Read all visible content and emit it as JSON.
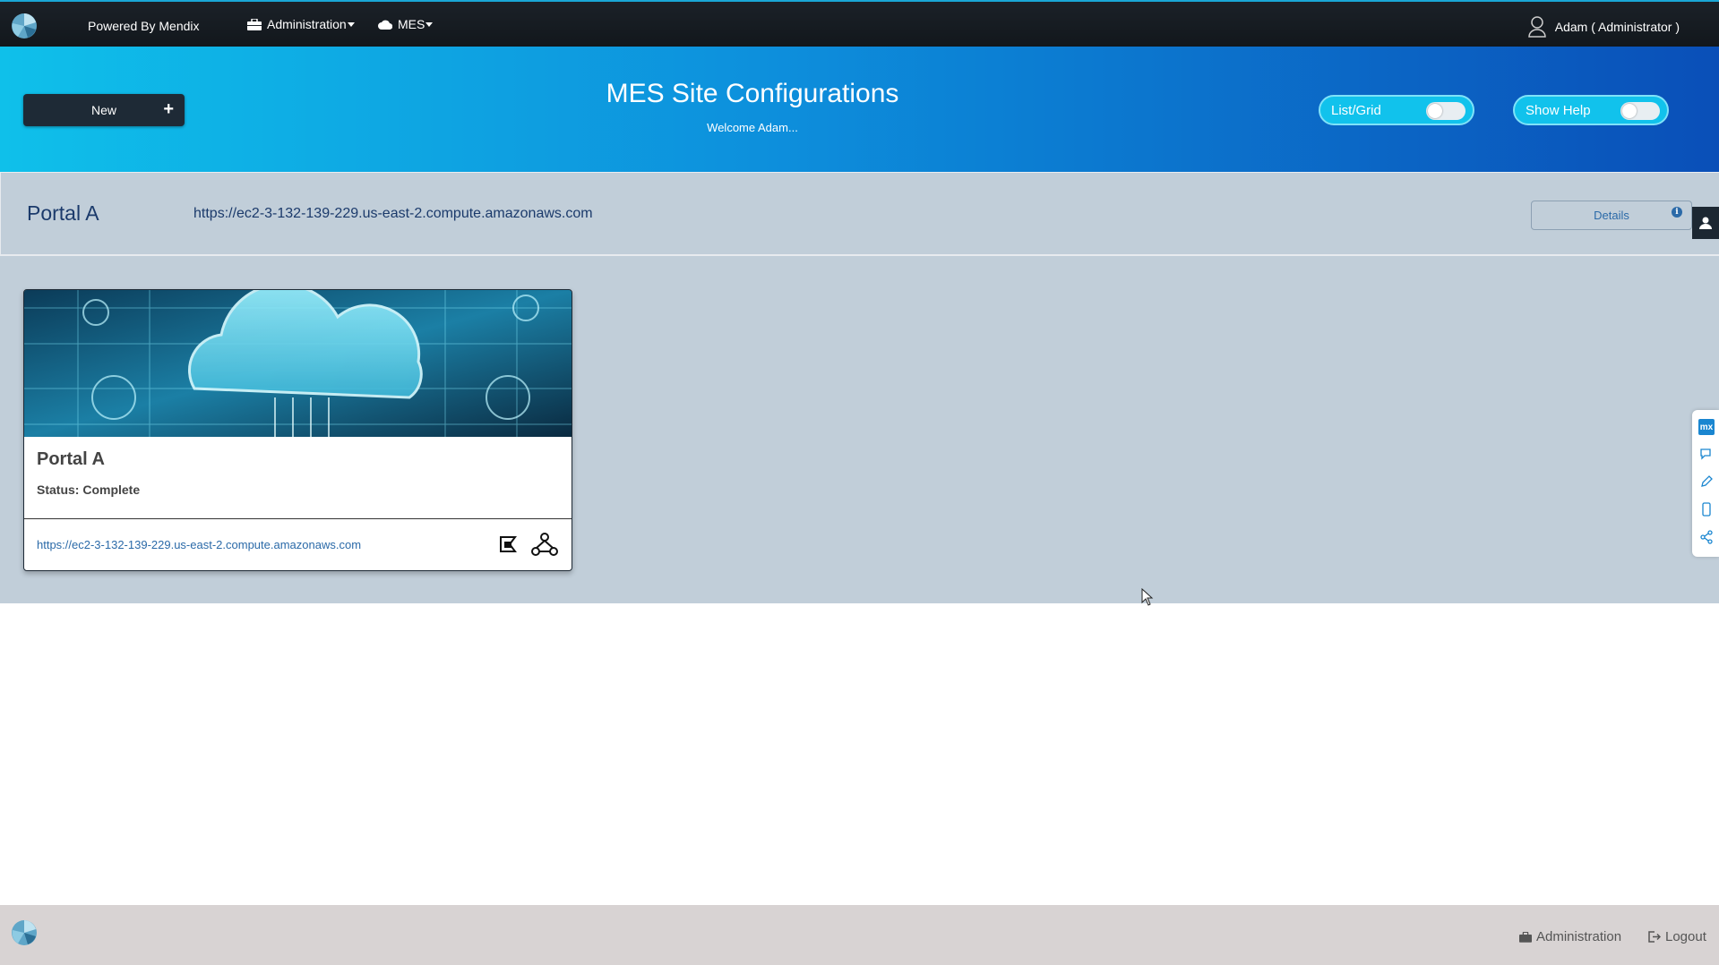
{
  "topbar": {
    "powered_by": "Powered By Mendix",
    "menu_admin": "Administration",
    "menu_mes": "MES",
    "user": "Adam ( Administrator )"
  },
  "banner": {
    "new_label": "New",
    "title": "MES Site Configurations",
    "welcome": "Welcome Adam...",
    "toggle_list_grid": "List/Grid",
    "toggle_show_help": "Show Help"
  },
  "portal_bar": {
    "name": "Portal A",
    "url": "https://ec2-3-132-139-229.us-east-2.compute.amazonaws.com",
    "details_label": "Details"
  },
  "card": {
    "title": "Portal A",
    "status": "Status: Complete",
    "link": "https://ec2-3-132-139-229.us-east-2.compute.amazonaws.com"
  },
  "sidetools": {
    "mx_label": "mx"
  },
  "footer": {
    "admin": "Administration",
    "logout": "Logout"
  },
  "colors": {
    "accent": "#0fc0ea",
    "brand_dark": "#1e2a36",
    "link": "#2b6aa8",
    "main_bg": "#c1ced9"
  },
  "icons": [
    "app-logo-icon",
    "briefcase-icon",
    "cloud-icon",
    "caret-down-icon",
    "user-icon",
    "plus-icon",
    "info-icon",
    "user-profile-icon",
    "mx-icon",
    "chat-icon",
    "pencil-icon",
    "mobile-icon",
    "share-icon",
    "deploy-icon",
    "network-icon",
    "logout-icon"
  ]
}
